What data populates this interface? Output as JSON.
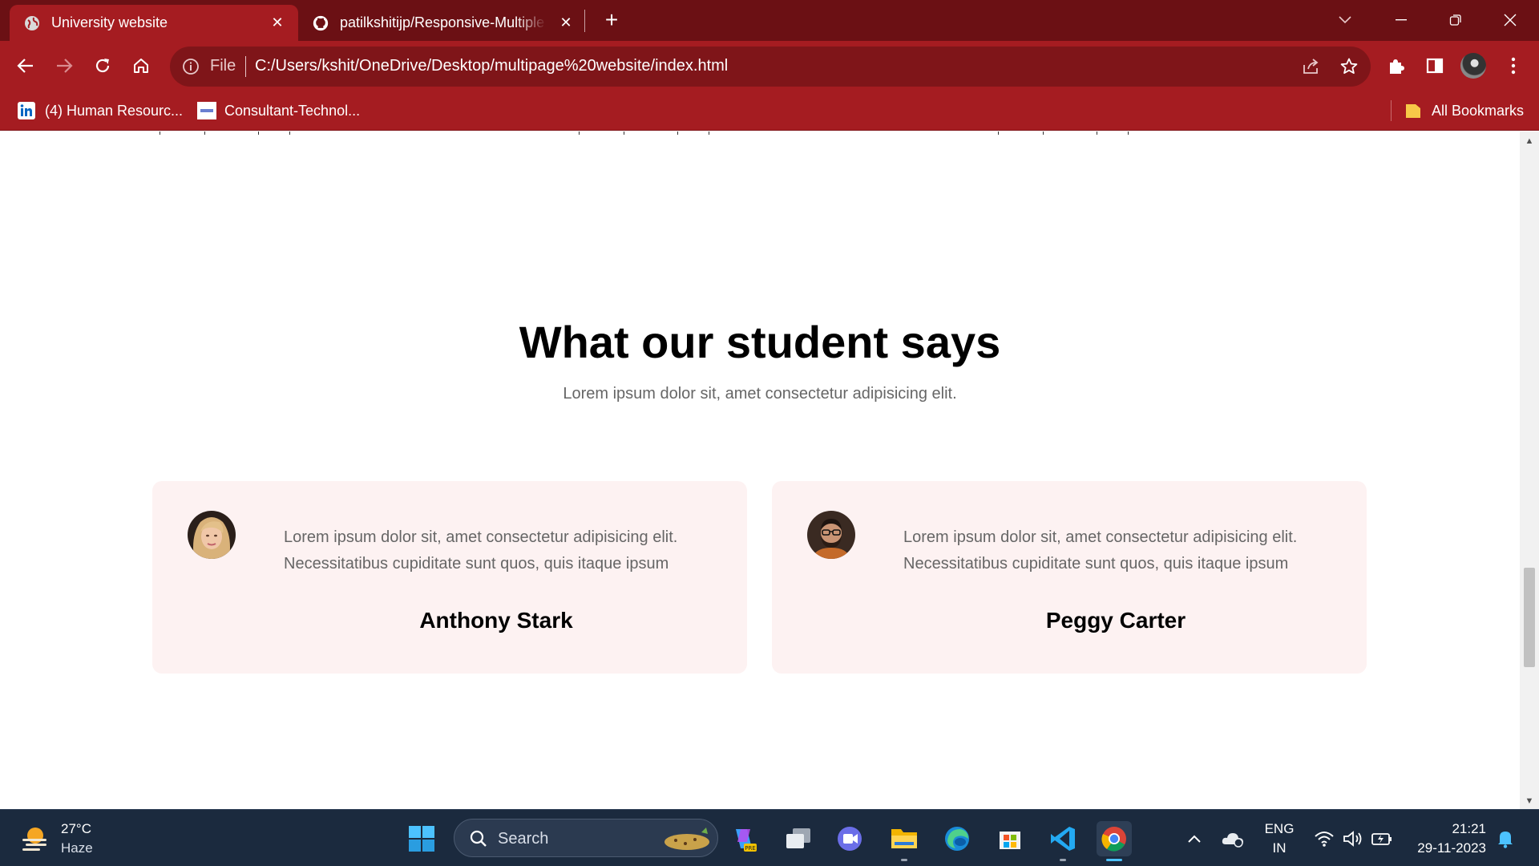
{
  "browser": {
    "tabs": [
      {
        "title": "University website",
        "active": true
      },
      {
        "title": "patilkshitijp/Responsive-Multiple",
        "active": false
      }
    ],
    "address": {
      "scheme_label": "File",
      "url": "C:/Users/kshit/OneDrive/Desktop/multipage%20website/index.html"
    },
    "bookmarks": [
      {
        "label": "(4) Human Resourc...",
        "icon": "linkedin-icon"
      },
      {
        "label": "Consultant-Technol...",
        "icon": "site-icon"
      }
    ],
    "all_bookmarks_label": "All Bookmarks",
    "colors": {
      "frame": "#6b1014",
      "toolbar": "#a51c21",
      "omnibox": "#7f1519"
    }
  },
  "page": {
    "testimonials": {
      "heading": "What our student says",
      "subheading": "Lorem ipsum dolor sit, amet consectetur adipisicing elit.",
      "cards": [
        {
          "quote": "Lorem ipsum dolor sit, amet consectetur adipisicing elit. Necessitatibus cupiditate sunt quos, quis itaque ipsum",
          "name": "Anthony Stark",
          "avatar": "woman-avatar"
        },
        {
          "quote": "Lorem ipsum dolor sit, amet consectetur adipisicing elit. Necessitatibus cupiditate sunt quos, quis itaque ipsum",
          "name": "Peggy Carter",
          "avatar": "man-avatar"
        }
      ],
      "card_color": "#fdf2f2"
    }
  },
  "taskbar": {
    "weather": {
      "temp": "27°C",
      "condition": "Haze"
    },
    "search_label": "Search",
    "language": {
      "line1": "ENG",
      "line2": "IN"
    },
    "clock": {
      "time": "21:21",
      "date": "29-11-2023"
    }
  }
}
